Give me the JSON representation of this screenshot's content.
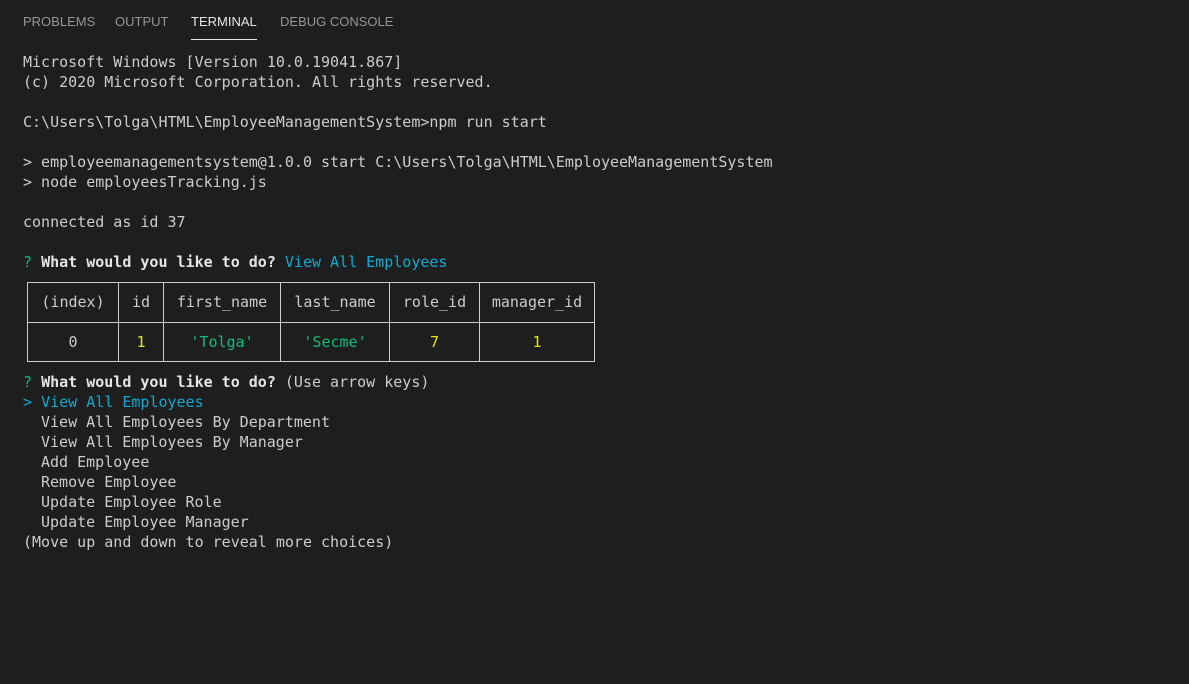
{
  "tabs": [
    {
      "label": "PROBLEMS"
    },
    {
      "label": "OUTPUT"
    },
    {
      "label": "TERMINAL"
    },
    {
      "label": "DEBUG CONSOLE"
    }
  ],
  "terminal": {
    "banner1": "Microsoft Windows [Version 10.0.19041.867]",
    "banner2": "(c) 2020 Microsoft Corporation. All rights reserved.",
    "command": "C:\\Users\\Tolga\\HTML\\EmployeeManagementSystem>npm run start",
    "npm1": "> employeemanagementsystem@1.0.0 start C:\\Users\\Tolga\\HTML\\EmployeeManagementSystem",
    "npm2": "> node employeesTracking.js",
    "connected": "connected as id 37",
    "q_mark": "?",
    "question": "What would you like to do?",
    "answer": "View All Employees",
    "hint": "(Use arrow keys)",
    "pointer": ">",
    "choices": [
      "View All Employees",
      "View All Employees By Department",
      "View All Employees By Manager",
      "Add Employee",
      "Remove Employee",
      "Update Employee Role",
      "Update Employee Manager"
    ],
    "more": "(Move up and down to reveal more choices)"
  },
  "table": {
    "headers": [
      "(index)",
      "id",
      "first_name",
      "last_name",
      "role_id",
      "manager_id"
    ],
    "row": [
      "0",
      "1",
      "'Tolga'",
      "'Secme'",
      "7",
      "1"
    ],
    "row_colors": [
      "#cccccc",
      "#e5e510",
      "#0dbc79",
      "#0dbc79",
      "#e5e510",
      "#e5e510"
    ]
  },
  "colors": {
    "background": "#1e1e1e",
    "text": "#cccccc",
    "green": "#0dbc79",
    "cyan": "#11a8cd",
    "yellow": "#e5e510"
  }
}
